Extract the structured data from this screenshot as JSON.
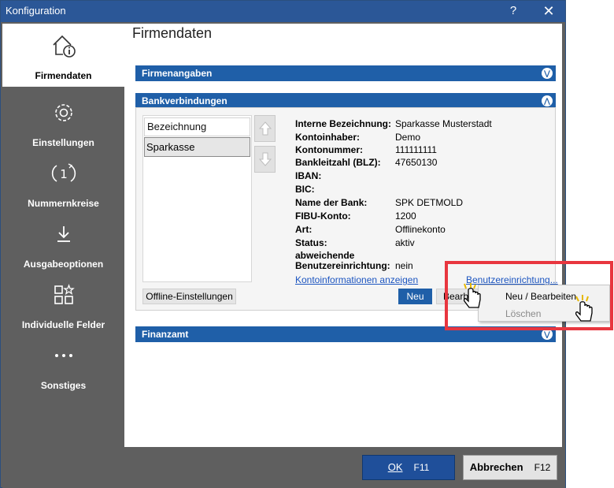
{
  "window": {
    "title": "Konfiguration",
    "help_label": "?",
    "close_label": "✕"
  },
  "sidebar": {
    "items": [
      {
        "label": "Firmendaten",
        "icon": "home-info-icon",
        "active": true
      },
      {
        "label": "Einstellungen",
        "icon": "gear-icon"
      },
      {
        "label": "Nummernkreise",
        "icon": "number-cycle-icon"
      },
      {
        "label": "Ausgabeoptionen",
        "icon": "download-icon"
      },
      {
        "label": "Individuelle Felder",
        "icon": "custom-fields-icon"
      },
      {
        "label": "Sonstiges",
        "icon": "more-icon"
      }
    ]
  },
  "main": {
    "title": "Firmendaten",
    "sections": {
      "firmenangaben": "Firmenangaben",
      "bankverbindungen": "Bankverbindungen",
      "finanzamt": "Finanzamt"
    },
    "bank_list": {
      "header": "Bezeichnung",
      "rows": [
        "Sparkasse"
      ]
    },
    "details": [
      {
        "label": "Interne Bezeichnung:",
        "value": "Sparkasse Musterstadt"
      },
      {
        "label": "Kontoinhaber:",
        "value": "Demo"
      },
      {
        "label": "Kontonummer:",
        "value": "111111111"
      },
      {
        "label": "Bankleitzahl (BLZ):",
        "value": "47650130"
      },
      {
        "label": "IBAN:",
        "value": ""
      },
      {
        "label": "BIC:",
        "value": ""
      },
      {
        "label": "Name der Bank:",
        "value": "SPK DETMOLD"
      },
      {
        "label": "FIBU-Konto:",
        "value": "1200"
      },
      {
        "label": "Art:",
        "value": "Offlinekonto"
      },
      {
        "label": "Status:",
        "value": "aktiv"
      }
    ],
    "abweichende": {
      "label_line1": "abweichende",
      "label_line2": "Benutzereinrichtung:",
      "value": "nein"
    },
    "links": {
      "kontoinfo": "Kontoinformationen anzeigen",
      "benutzer": "Benutzereinrichtung..."
    },
    "buttons": {
      "offline": "Offline-Einstellungen",
      "neu": "Neu",
      "bearbeiten": "Bearb"
    }
  },
  "context_menu": {
    "items": [
      {
        "label": "Neu / Bearbeiten",
        "enabled": true
      },
      {
        "label": "Löschen",
        "enabled": false
      }
    ]
  },
  "footer": {
    "ok": "OK",
    "ok_key": "F11",
    "cancel": "Abbrechen",
    "cancel_key": "F12"
  },
  "colors": {
    "accent": "#1f5fa8",
    "titlebar": "#2b5797",
    "highlight": "#e8363f",
    "sidebar": "#5f5f5f"
  }
}
